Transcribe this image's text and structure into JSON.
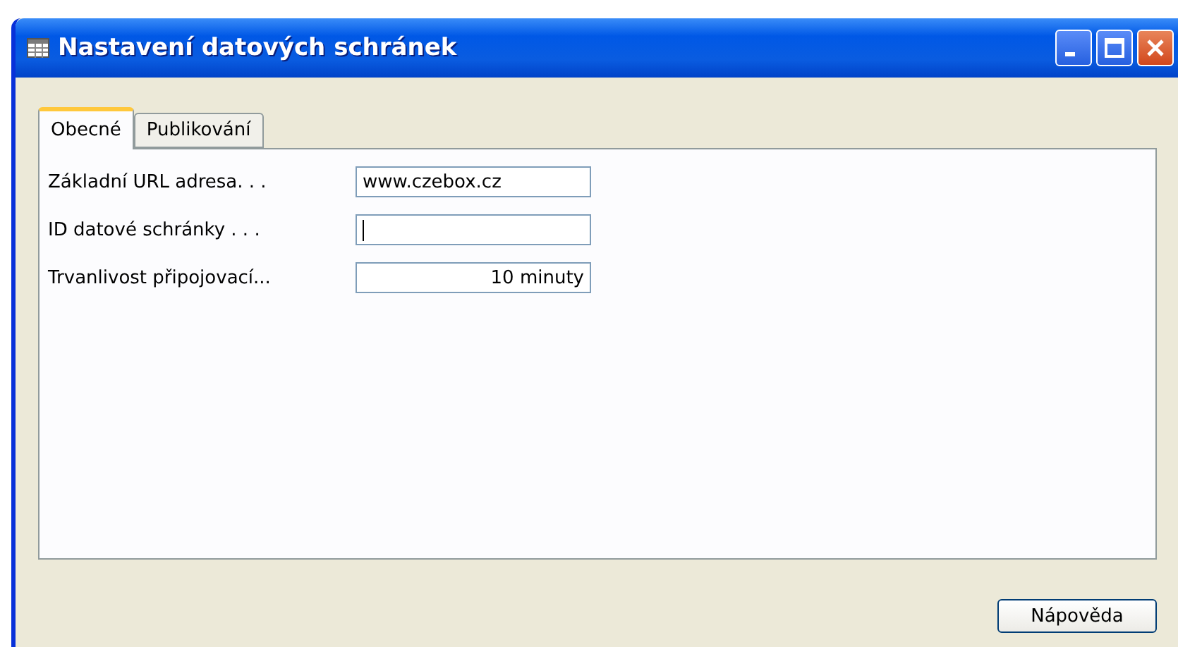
{
  "window": {
    "title": "Nastavení datových schránek"
  },
  "tabs": [
    {
      "label": "Obecné",
      "selected": true
    },
    {
      "label": "Publikování",
      "selected": false
    }
  ],
  "fields": [
    {
      "label": "Základní URL adresa. . .",
      "value": "www.czebox.cz",
      "kind": "text",
      "focused": false
    },
    {
      "label": "ID datové schránky . . .",
      "kind": "text",
      "focused": true
    },
    {
      "label": "Trvanlivost připojovací...",
      "value": "10 minuty",
      "kind": "duration",
      "focused": false
    }
  ],
  "buttons": [
    "Nápověda"
  ]
}
